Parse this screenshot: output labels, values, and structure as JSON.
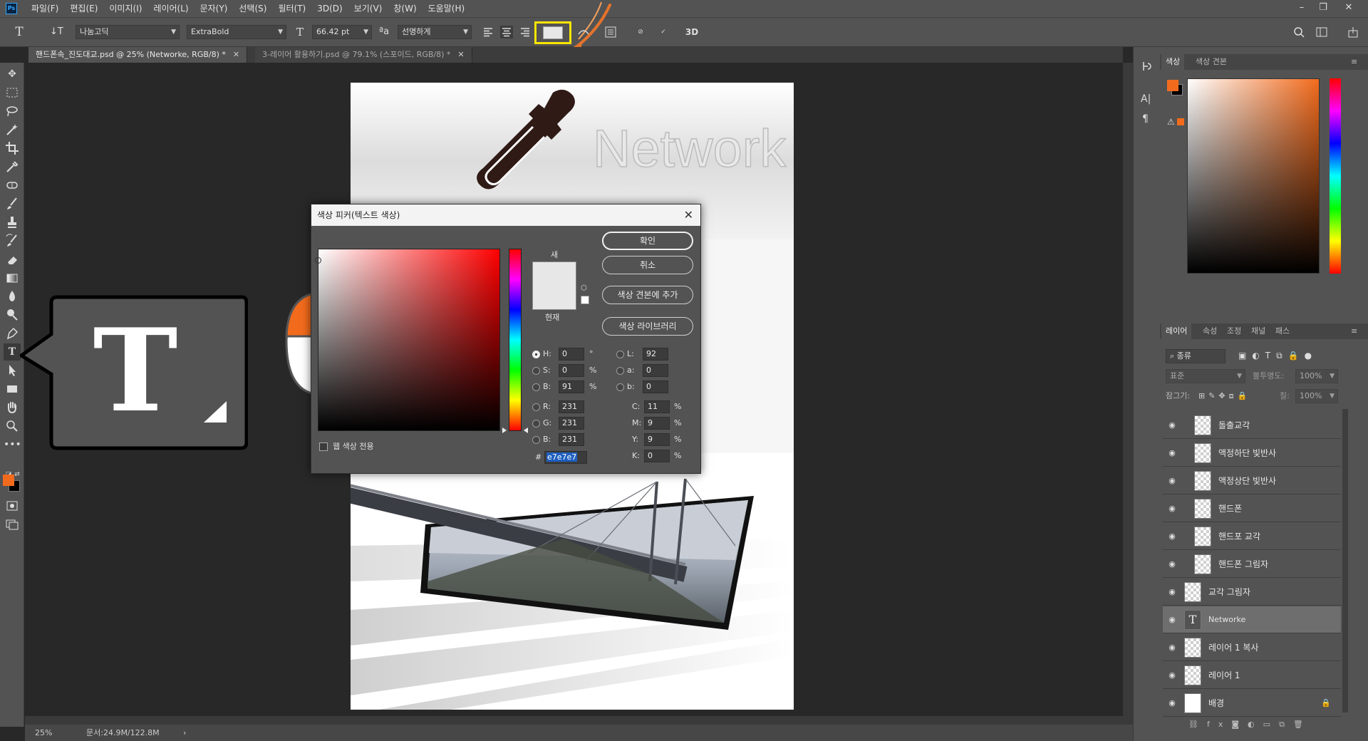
{
  "app": {
    "logo": "Ps"
  },
  "menu": [
    "파일(F)",
    "편집(E)",
    "이미지(I)",
    "레이어(L)",
    "문자(Y)",
    "선택(S)",
    "필터(T)",
    "3D(D)",
    "보기(V)",
    "창(W)",
    "도움말(H)"
  ],
  "window_controls": {
    "minimize": "–",
    "restore": "❐",
    "close": "✕"
  },
  "options": {
    "tool_glyph": "T",
    "orient_glyph": "↓T",
    "font_family": "나눔고딕",
    "font_style": "ExtraBold",
    "size_glyph": "T",
    "font_size": "66.42 pt",
    "aa_glyph": "ªa",
    "antialias": "선명하게",
    "color_swatch_hex": "#e7e7e7",
    "btn_3d": "3D"
  },
  "tabs": [
    {
      "title": "핸드폰속_진도대교.psd @ 25% (Networke, RGB/8) *",
      "close": "✕",
      "active": true
    },
    {
      "title": "3-레이어 활용하기.psd @ 79.1% (스포이드, RGB/8) *",
      "close": "✕",
      "active": false
    }
  ],
  "document": {
    "headline": "Network"
  },
  "tool_callout": {
    "glyph": "T"
  },
  "status": {
    "zoom": "25%",
    "doc_size": "문서:24.9M/122.8M",
    "arrow": "›"
  },
  "color_panel": {
    "tabs": [
      "색상",
      "색상 견본"
    ],
    "fg": "#f26b1d",
    "bg": "#000000",
    "warning_glyph": "⚠"
  },
  "layers_panel": {
    "tabs": [
      "레이어",
      "속성",
      "조정",
      "채널",
      "패스"
    ],
    "filter_label": "종류",
    "blend_mode": "표준",
    "opacity_label": "불투명도:",
    "opacity_value": "100%",
    "lock_label": "잠그기:",
    "fill_label": "칠:",
    "fill_value": "100%",
    "layers": [
      {
        "name": "돌출교각",
        "kind": "raster",
        "clipped": true
      },
      {
        "name": "액정하단 빛반사",
        "kind": "raster",
        "clipped": true
      },
      {
        "name": "액정상단 빛반사",
        "kind": "raster",
        "clipped": true
      },
      {
        "name": "핸드폰",
        "kind": "raster",
        "clipped": true
      },
      {
        "name": "핸드포 교각",
        "kind": "raster",
        "clipped": true
      },
      {
        "name": "핸드폰 그림자",
        "kind": "raster",
        "clipped": true
      },
      {
        "name": "교각 그림자",
        "kind": "raster",
        "clipped": false
      },
      {
        "name": "Networke",
        "kind": "text",
        "clipped": false,
        "selected": true
      },
      {
        "name": "레이어 1 복사",
        "kind": "raster",
        "clipped": false
      },
      {
        "name": "레이어 1",
        "kind": "raster",
        "clipped": false
      },
      {
        "name": "배경",
        "kind": "background",
        "clipped": false,
        "locked": true
      }
    ],
    "footer_icons": [
      "link-icon",
      "fx-icon",
      "mask-icon",
      "adjustment-icon",
      "folder-icon",
      "new-layer-icon",
      "trash-icon"
    ],
    "footer_fx": "fx"
  },
  "color_picker": {
    "title": "색상 피커(텍스트 색상)",
    "close": "✕",
    "ok": "확인",
    "cancel": "취소",
    "add_swatch": "색상 견본에 추가",
    "color_library": "색상 라이브러리",
    "new_label": "새",
    "current_label": "현재",
    "web_only": "웹 색상 전용",
    "hex_label": "#",
    "hex": "e7e7e7",
    "swatch_new": "#e7e7e7",
    "swatch_current": "#e7e7e7",
    "hue_color": "#ff0000",
    "fields": {
      "H": {
        "label": "H:",
        "value": "0",
        "unit": "°"
      },
      "S": {
        "label": "S:",
        "value": "0",
        "unit": "%"
      },
      "B": {
        "label": "B:",
        "value": "91",
        "unit": "%"
      },
      "R": {
        "label": "R:",
        "value": "231"
      },
      "G": {
        "label": "G:",
        "value": "231"
      },
      "Bl": {
        "label": "B:",
        "value": "231"
      },
      "L": {
        "label": "L:",
        "value": "92"
      },
      "a": {
        "label": "a:",
        "value": "0"
      },
      "b": {
        "label": "b:",
        "value": "0"
      },
      "C": {
        "label": "C:",
        "value": "11",
        "unit": "%"
      },
      "M": {
        "label": "M:",
        "value": "9",
        "unit": "%"
      },
      "Y": {
        "label": "Y:",
        "value": "9",
        "unit": "%"
      },
      "K": {
        "label": "K:",
        "value": "0",
        "unit": "%"
      }
    }
  },
  "colors": {
    "highlight": "#ffe600",
    "accent": "#f26b1d",
    "selection": "#1f5fbf"
  }
}
